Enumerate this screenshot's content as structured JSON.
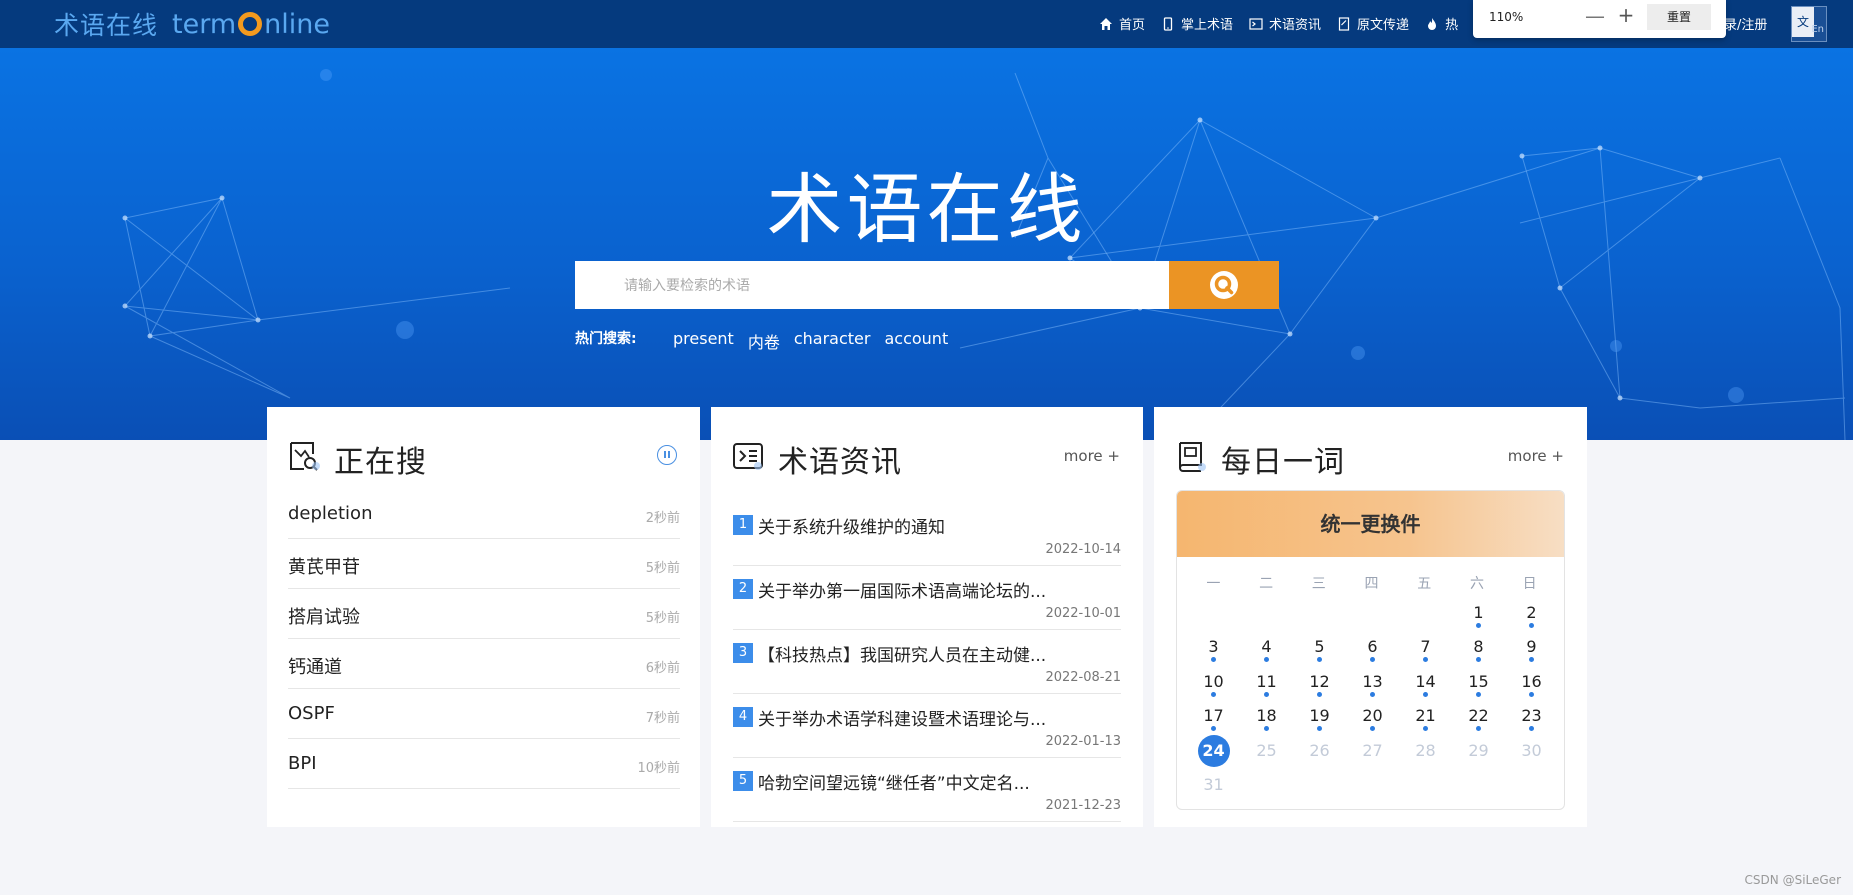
{
  "logo": {
    "cn": "术语在线",
    "en_left": "term",
    "en_right": "nline"
  },
  "nav": {
    "items": [
      {
        "label": "首页",
        "icon": "home-icon"
      },
      {
        "label": "掌上术语",
        "icon": "mobile-icon"
      },
      {
        "label": "术语资讯",
        "icon": "news-icon"
      },
      {
        "label": "原文传递",
        "icon": "document-icon"
      },
      {
        "label": "热",
        "icon": "fire-icon"
      }
    ],
    "login": "录/注册",
    "lang_cn": "文",
    "lang_en": "En"
  },
  "zoom_popup": {
    "level": "110%",
    "minus": "—",
    "plus": "+",
    "reset": "重置"
  },
  "hero": {
    "title": "术语在线",
    "search_placeholder": "请输入要检索的术语",
    "hot_label": "热门搜索:",
    "hot_terms": [
      "present",
      "内卷",
      "character",
      "account"
    ]
  },
  "searching": {
    "title": "正在搜",
    "items": [
      {
        "term": "depletion",
        "time": "2秒前"
      },
      {
        "term": "黄芪甲苷",
        "time": "5秒前"
      },
      {
        "term": "搭肩试验",
        "time": "5秒前"
      },
      {
        "term": "钙通道",
        "time": "6秒前"
      },
      {
        "term": "OSPF",
        "time": "7秒前"
      },
      {
        "term": "BPI",
        "time": "10秒前"
      }
    ]
  },
  "news": {
    "title": "术语资讯",
    "more": "more +",
    "items": [
      {
        "num": "1",
        "title": "关于系统升级维护的通知",
        "date": "2022-10-14"
      },
      {
        "num": "2",
        "title": "关于举办第一届国际术语高端论坛的...",
        "date": "2022-10-01"
      },
      {
        "num": "3",
        "title": "【科技热点】我国研究人员在主动健...",
        "date": "2022-08-21"
      },
      {
        "num": "4",
        "title": "关于举办术语学科建设暨术语理论与...",
        "date": "2022-01-13"
      },
      {
        "num": "5",
        "title": "哈勃空间望远镜“继任者”中文定名...",
        "date": "2021-12-23"
      }
    ]
  },
  "daily": {
    "title": "每日一词",
    "more": "more +",
    "calendar_header": "统一更换件",
    "weekdays": [
      "一",
      "二",
      "三",
      "四",
      "五",
      "六",
      "日"
    ],
    "days": [
      {
        "d": "1",
        "dot": true
      },
      {
        "d": "2",
        "dot": true
      },
      {
        "d": "3",
        "dot": true
      },
      {
        "d": "4",
        "dot": true
      },
      {
        "d": "5",
        "dot": true
      },
      {
        "d": "6",
        "dot": true
      },
      {
        "d": "7",
        "dot": true
      },
      {
        "d": "8",
        "dot": true
      },
      {
        "d": "9",
        "dot": true
      },
      {
        "d": "10",
        "dot": true
      },
      {
        "d": "11",
        "dot": true
      },
      {
        "d": "12",
        "dot": true
      },
      {
        "d": "13",
        "dot": true
      },
      {
        "d": "14",
        "dot": true
      },
      {
        "d": "15",
        "dot": true
      },
      {
        "d": "16",
        "dot": true
      },
      {
        "d": "17",
        "dot": true
      },
      {
        "d": "18",
        "dot": true
      },
      {
        "d": "19",
        "dot": true
      },
      {
        "d": "20",
        "dot": true
      },
      {
        "d": "21",
        "dot": true
      },
      {
        "d": "22",
        "dot": true
      },
      {
        "d": "23",
        "dot": true
      },
      {
        "d": "24",
        "today": true
      },
      {
        "d": "25",
        "future": true
      },
      {
        "d": "26",
        "future": true
      },
      {
        "d": "27",
        "future": true
      },
      {
        "d": "28",
        "future": true
      },
      {
        "d": "29",
        "future": true
      },
      {
        "d": "30",
        "future": true
      },
      {
        "d": "31",
        "future": true
      }
    ]
  },
  "watermark": "CSDN @SiLeGer",
  "colors": {
    "nav_bg": "#053a7e",
    "hero_blue": "#0a6ad8",
    "accent_orange": "#eb9424",
    "link_blue": "#2c7ce0"
  }
}
